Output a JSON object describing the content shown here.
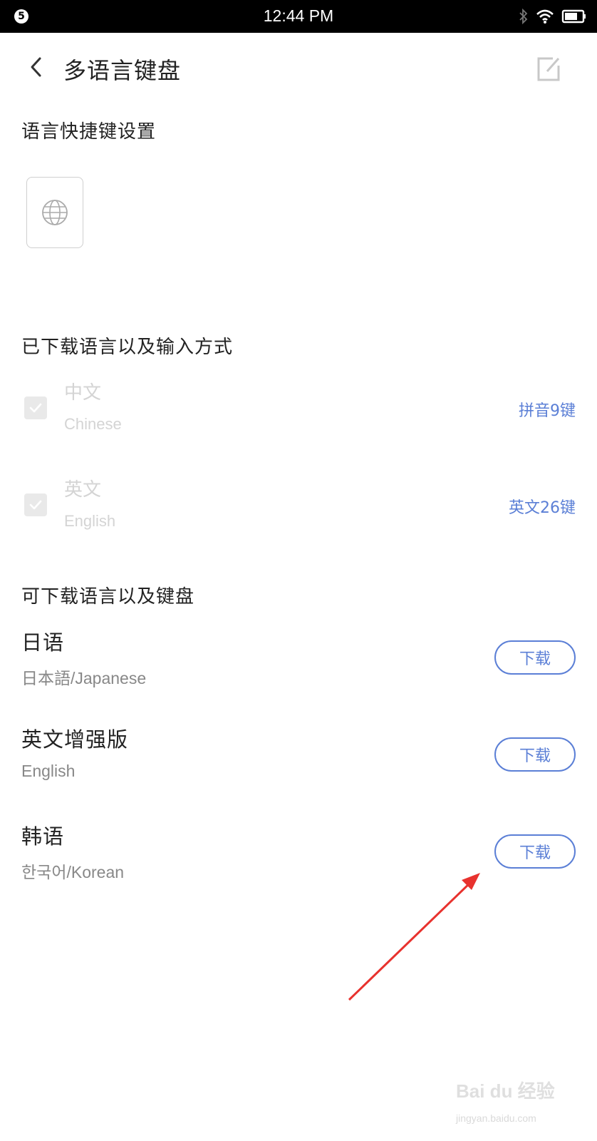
{
  "status_bar": {
    "notification_count": "5",
    "time": "12:44 PM",
    "icons": [
      "bluetooth-icon",
      "wifi-icon",
      "battery-icon"
    ]
  },
  "app_bar": {
    "title": "多语言键盘",
    "back_icon": "chevron-left-icon",
    "edit_icon": "edit-icon"
  },
  "shortcut_section": {
    "title": "语言快捷键设置",
    "key_icon": "globe-icon"
  },
  "downloaded_section": {
    "title": "已下载语言以及输入方式",
    "items": [
      {
        "name": "中文",
        "subtitle": "Chinese",
        "method": "拼音9键",
        "checked": true
      },
      {
        "name": "英文",
        "subtitle": "English",
        "method": "英文26键",
        "checked": true
      }
    ]
  },
  "available_section": {
    "title": "可下载语言以及键盘",
    "items": [
      {
        "name": "日语",
        "subtitle": "日本語/Japanese",
        "button": "下载"
      },
      {
        "name": "英文增强版",
        "subtitle": "English",
        "button": "下载"
      },
      {
        "name": "韩语",
        "subtitle": "한국어/Korean",
        "button": "下载"
      }
    ]
  },
  "watermark": {
    "brand": "Bai du 经验",
    "url": "jingyan.baidu.com"
  },
  "colors": {
    "accent": "#5b7fd6",
    "arrow": "#e8322e"
  }
}
